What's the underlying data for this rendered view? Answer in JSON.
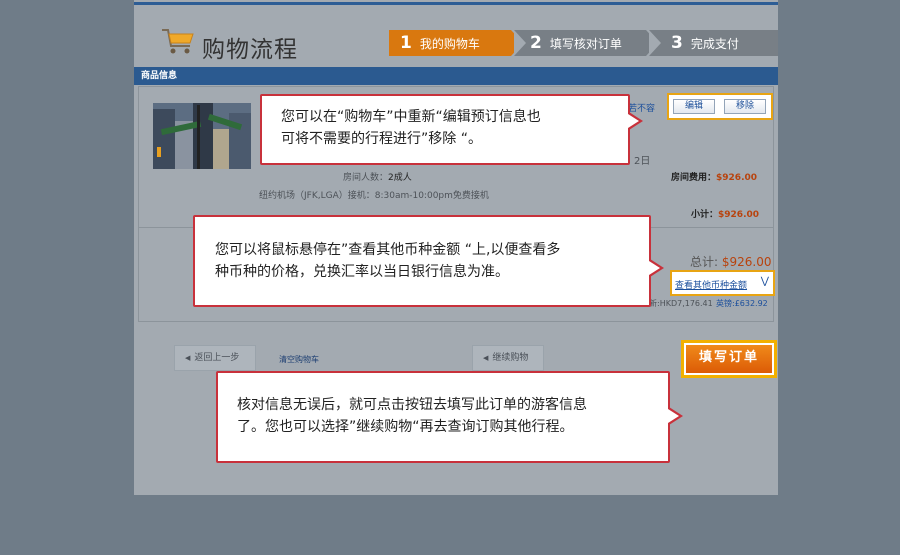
{
  "header": {
    "title": "购物流程",
    "steps": [
      {
        "num": "1",
        "label": "我的购物车"
      },
      {
        "num": "2",
        "label": "填写核对订单"
      },
      {
        "num": "3",
        "label": "完成支付"
      }
    ]
  },
  "section": {
    "title": "商品信息"
  },
  "item": {
    "room_guests_label": "房间人数：",
    "room_guests_value": "2成人",
    "pickup": "纽约机场（JFK,LGA）接机：8:30am-10:00pm免费接机",
    "date_tail": "2日",
    "truncated_link": "若不容",
    "room_fee_label": "房间费用：",
    "room_fee_value": "$926.00",
    "subtotal_label": "小计：",
    "subtotal_value": "$926.00"
  },
  "actions": {
    "edit": "编辑",
    "remove": "移除"
  },
  "totals": {
    "total_label": "总计:",
    "total_value": "$926.00",
    "other_currency_link": "查看其他币种金额",
    "hkd_text": "新:HKD7,176.41",
    "gbp_text": "英镑:£632.92"
  },
  "nav": {
    "back": "返回上一步",
    "clear_cart": "清空购物车",
    "continue": "继续购物",
    "fill_order": "填写订单"
  },
  "callouts": {
    "one": [
      "您可以在“购物车”中重新“编辑预订信息也",
      "可将不需要的行程进行”移除 “。"
    ],
    "two": [
      "您可以将鼠标悬停在”查看其他币种金额 “上,以便查看多",
      "种币种的价格，兑换汇率以当日银行信息为准。"
    ],
    "three": [
      "核对信息无误后，就可点击按钮去填写此订单的游客信息",
      "了。您也可以选择”继续购物“再去查询订购其他行程。"
    ]
  },
  "colors": {
    "accent_orange": "#d9780f",
    "brand_blue": "#2b5a90",
    "callout_border": "#c8313b",
    "highlight_frame": "#e8a413"
  }
}
